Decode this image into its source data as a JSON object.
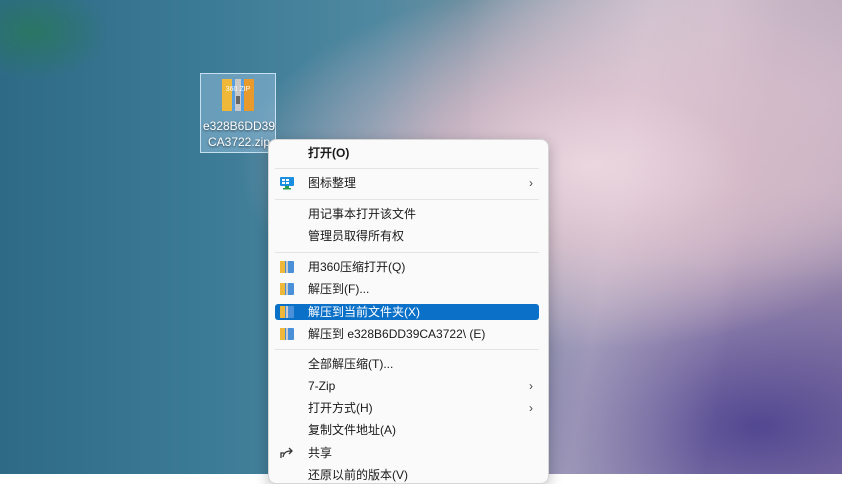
{
  "desktop": {
    "file_icon": {
      "name": "e328B6DD39CA3722.zip",
      "badge_text": "360 ZIP"
    }
  },
  "context_menu": {
    "items": [
      {
        "label": "打开(O)",
        "bold": true
      },
      {
        "label": "图标整理",
        "submenu": true,
        "icon": "desktop-arrange-icon"
      },
      {
        "label": "用记事本打开该文件"
      },
      {
        "label": "管理员取得所有权"
      },
      {
        "label": "用360压缩打开(Q)",
        "icon": "zip-icon"
      },
      {
        "label": "解压到(F)...",
        "icon": "zip-icon"
      },
      {
        "label": "解压到当前文件夹(X)",
        "icon": "zip-icon",
        "highlighted": true
      },
      {
        "label": "解压到 e328B6DD39CA3722\\ (E)",
        "icon": "zip-icon"
      },
      {
        "label": "全部解压缩(T)..."
      },
      {
        "label": "7-Zip",
        "submenu": true
      },
      {
        "label": "打开方式(H)",
        "submenu": true
      },
      {
        "label": "复制文件地址(A)"
      },
      {
        "label": "共享",
        "icon": "share-icon"
      },
      {
        "label": "还原以前的版本(V)"
      }
    ],
    "submenu_arrow": "›"
  },
  "colors": {
    "highlight": "#0a70c8",
    "menu_bg": "#fafafa"
  }
}
